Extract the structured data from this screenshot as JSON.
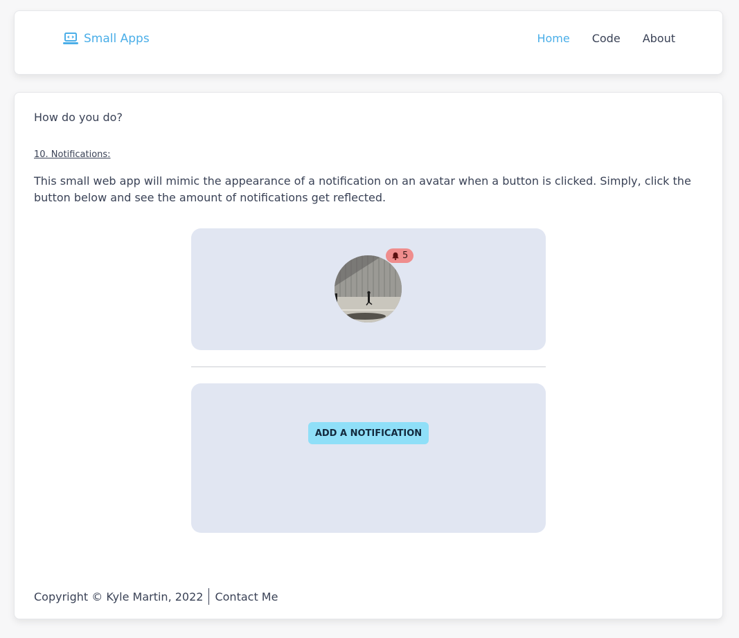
{
  "navbar": {
    "brand": "Small Apps",
    "brand_icon": "laptop-code-icon",
    "links": [
      {
        "label": "Home",
        "active": true
      },
      {
        "label": "Code",
        "active": false
      },
      {
        "label": "About",
        "active": false
      }
    ]
  },
  "main": {
    "greeting": "How do you do?",
    "section_title": "10. Notifications:",
    "description": "This small web app will mimic the appearance of a notification on an avatar when a button is clicked. Simply, click the button below and see the amount of notifications get reflected.",
    "avatar_icon": "avatar-photo",
    "notification_count": "5",
    "badge_icon": "bell-icon",
    "add_button_label": "ADD A NOTIFICATION"
  },
  "footer": {
    "copyright": "Copyright © Kyle Martin, 2022",
    "contact": "Contact Me"
  },
  "colors": {
    "accent": "#4aaee8",
    "panel_bg": "#e1e6f2",
    "badge_bg": "#ef8d8d",
    "button_bg": "#8fdff8",
    "text": "#3a4256"
  }
}
